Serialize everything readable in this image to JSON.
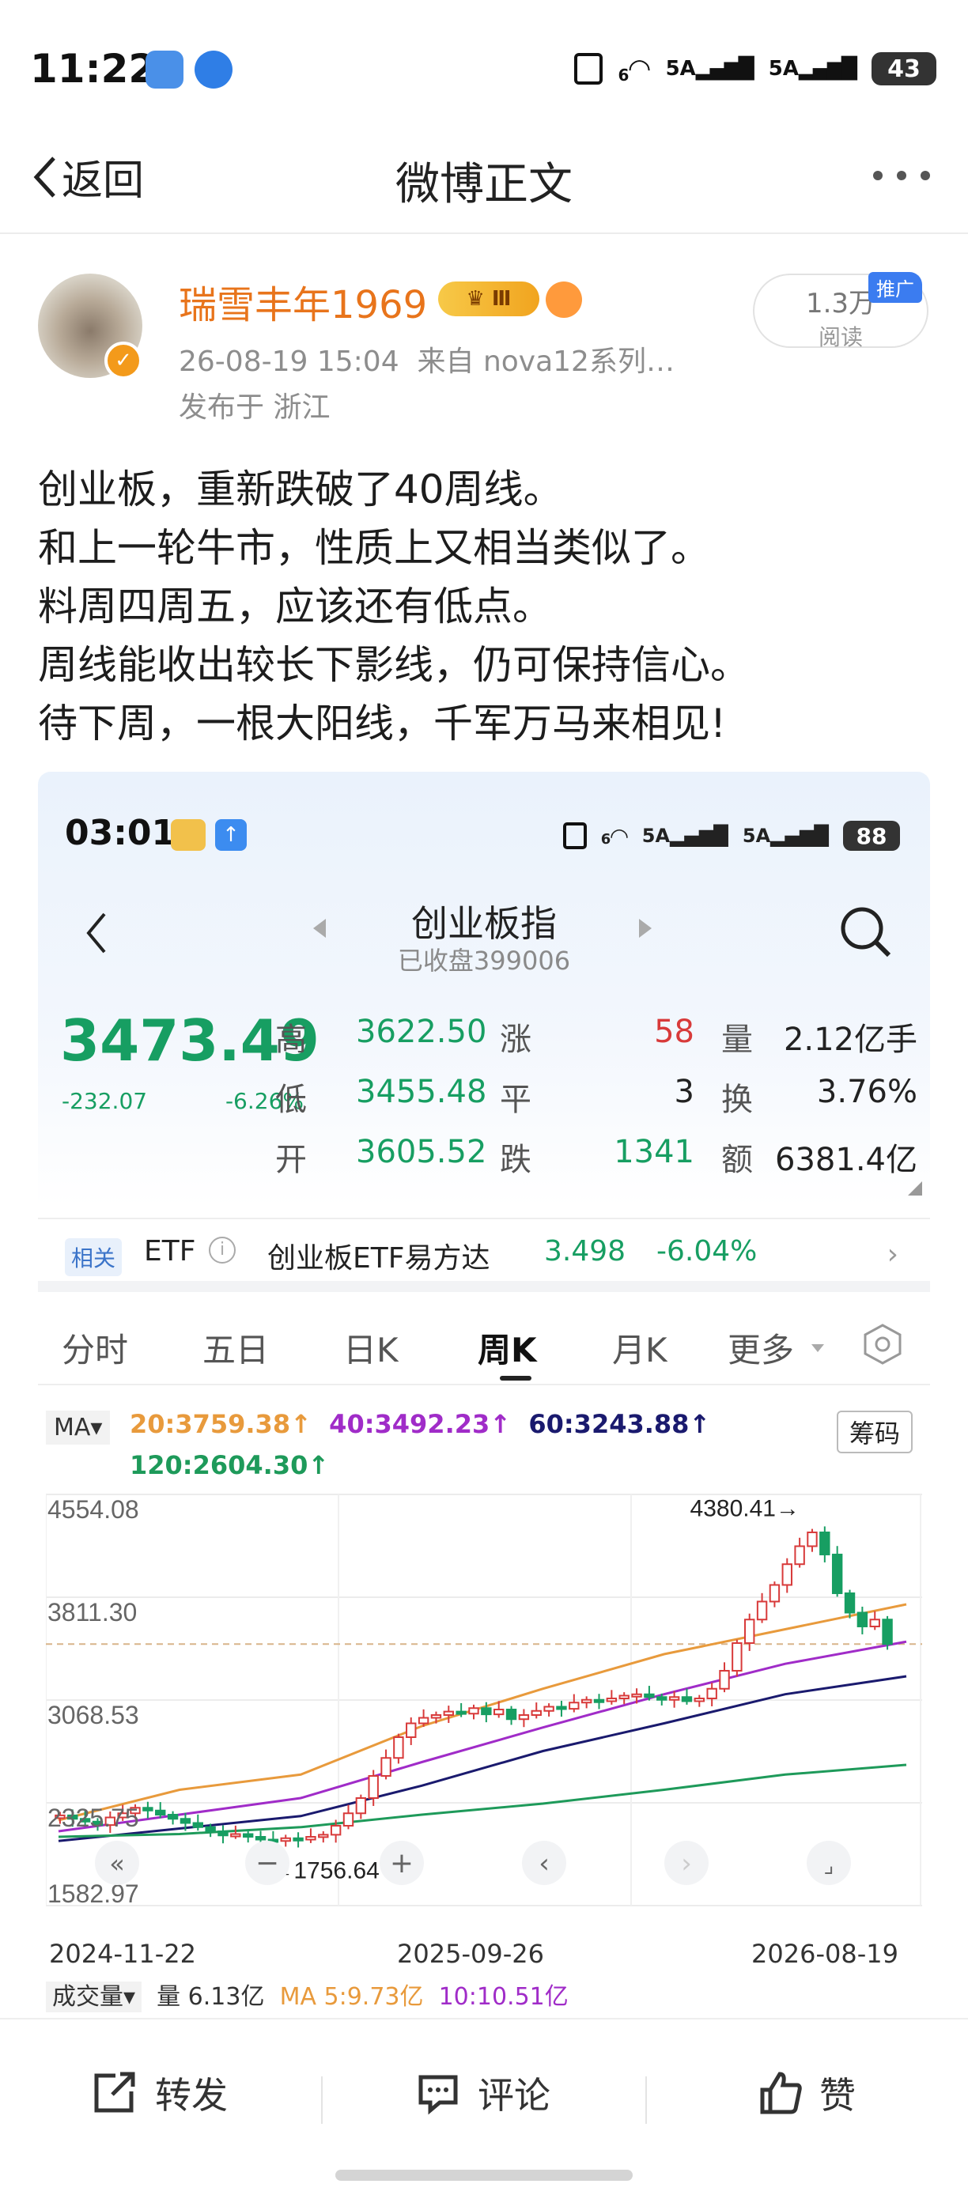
{
  "status_bar": {
    "time": "11:22",
    "battery": "43",
    "net1": "5A",
    "net2": "5A",
    "wifi": "6"
  },
  "nav": {
    "back_label": "返回",
    "title": "微博正文"
  },
  "post": {
    "author": "瑞雪丰年1969",
    "vip_level": "Ⅲ",
    "timestamp": "26-08-19 15:04",
    "source": "来自 nova12系列…",
    "location": "发布于 浙江",
    "reads_count": "1.3万",
    "reads_label": "阅读",
    "promo_label": "推广",
    "lines": [
      "创业板，重新跌破了40周线。",
      "和上一轮牛市，性质上又相当类似了。",
      "料周四周五，应该还有低点。",
      "周线能收出较长下影线，仍可保持信心。",
      "待下周，一根大阳线，千军万马来相见!"
    ]
  },
  "screenshot": {
    "status": {
      "time": "03:01",
      "battery": "88",
      "net1": "5A",
      "net2": "5A",
      "wifi": "6"
    },
    "title": "创业板指",
    "subtitle": "已收盘399006",
    "price": "3473.49",
    "change": "-232.07",
    "change_pct": "-6.26%",
    "quote": {
      "high_label": "高",
      "high": "3622.50",
      "low_label": "低",
      "low": "3455.48",
      "open_label": "开",
      "open": "3605.52",
      "up_label": "涨",
      "up": "58",
      "flat_label": "平",
      "flat": "3",
      "down_label": "跌",
      "down": "1341",
      "vol_label": "量",
      "vol": "2.12亿手",
      "turnover_label": "换",
      "turnover": "3.76%",
      "amount_label": "额",
      "amount": "6381.4亿"
    },
    "etf": {
      "tag": "相关",
      "label": "ETF",
      "info": "i",
      "name": "创业板ETF易方达",
      "value": "3.498",
      "pct": "-6.04%"
    },
    "tabs": [
      "分时",
      "五日",
      "日K",
      "周K",
      "月K",
      "更多"
    ],
    "active_tab": "周K",
    "ma_selector": "MA",
    "ma": {
      "ma20": "20:3759.38↑",
      "ma40": "40:3492.23↑",
      "ma60": "60:3243.88↑",
      "ma120": "120:2604.30↑"
    },
    "chips_button": "筹码",
    "volume": {
      "selector": "成交量",
      "vol": "量 6.13亿",
      "ma5": "MA 5:9.73亿",
      "ma10": "10:10.51亿"
    },
    "colors": {
      "up": "#d83a3a",
      "down": "#179e62",
      "ma20": "#e89a3c",
      "ma40": "#a02cc8",
      "ma60": "#1a1a6e",
      "ma120": "#1e9a5a"
    }
  },
  "chart_data": {
    "type": "candlestick",
    "title": "创业板指 周K",
    "ylim": [
      1582.97,
      4554.08
    ],
    "y_ticks": [
      "4554.08",
      "3811.30",
      "3068.53",
      "2325.75",
      "1582.97"
    ],
    "x_ticks": [
      "2024-11-22",
      "2025-09-26",
      "2026-08-19"
    ],
    "annotations": {
      "max": "4380.41→",
      "min": "←1756.64"
    },
    "closes": [
      2235,
      2210,
      2190,
      2165,
      2220,
      2250,
      2290,
      2270,
      2240,
      2210,
      2180,
      2150,
      2120,
      2090,
      2100,
      2080,
      2060,
      2050,
      2070,
      2060,
      2080,
      2095,
      2160,
      2250,
      2360,
      2520,
      2650,
      2800,
      2900,
      2940,
      2960,
      2985,
      2970,
      3010,
      2965,
      3000,
      2930,
      2960,
      2990,
      3020,
      3005,
      3050,
      3070,
      3060,
      3080,
      3100,
      3110,
      3090,
      3070,
      3090,
      3060,
      3080,
      3150,
      3280,
      3480,
      3650,
      3780,
      3900,
      4050,
      4180,
      4280,
      4120,
      3840,
      3700,
      3600,
      3650,
      3473
    ],
    "series": [
      {
        "name": "MA20",
        "values": [
          2200,
          2420,
          2530,
          2880,
          3150,
          3400,
          3580,
          3760
        ]
      },
      {
        "name": "MA40",
        "values": [
          2120,
          2240,
          2360,
          2620,
          2870,
          3110,
          3330,
          3490
        ]
      },
      {
        "name": "MA60",
        "values": [
          2050,
          2140,
          2230,
          2450,
          2700,
          2900,
          3110,
          3240
        ]
      },
      {
        "name": "MA120",
        "values": [
          2080,
          2100,
          2150,
          2240,
          2320,
          2420,
          2530,
          2600
        ]
      }
    ]
  },
  "bottom_bar": {
    "repost": "转发",
    "comment": "评论",
    "like": "赞"
  }
}
